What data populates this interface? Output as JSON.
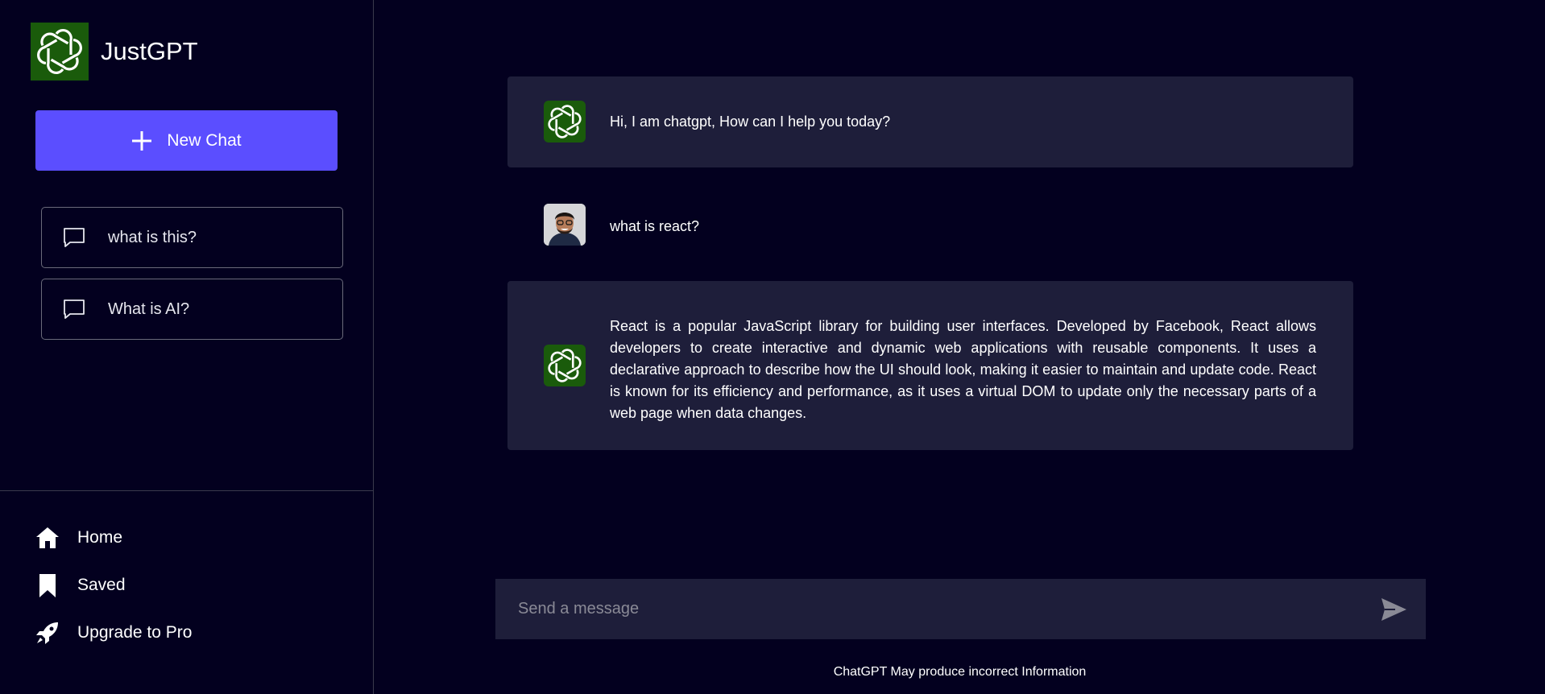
{
  "brand": {
    "name": "JustGPT",
    "logo_icon": "openai-logo-icon",
    "logo_bg": "#1a5b0b"
  },
  "sidebar": {
    "new_chat_label": "New Chat",
    "history": [
      {
        "label": "what is this?",
        "icon": "chat-bubble-icon"
      },
      {
        "label": "What is AI?",
        "icon": "chat-bubble-icon"
      }
    ],
    "nav": [
      {
        "label": "Home",
        "icon": "home-icon"
      },
      {
        "label": "Saved",
        "icon": "bookmark-icon"
      },
      {
        "label": "Upgrade to Pro",
        "icon": "rocket-icon"
      }
    ]
  },
  "chat": {
    "messages": [
      {
        "role": "bot",
        "text": "Hi, I am chatgpt, How can I help you today?"
      },
      {
        "role": "user",
        "text": "what is react?"
      },
      {
        "role": "bot",
        "text": "React is a popular JavaScript library for building user interfaces. Developed by Facebook, React allows developers to create interactive and dynamic web applications with reusable components. It uses a declarative approach to describe how the UI should look, making it easier to maintain and update code. React is known for its efficiency and performance, as it uses a virtual DOM to update only the necessary parts of a web page when data changes."
      }
    ]
  },
  "composer": {
    "placeholder": "Send a message",
    "send_icon": "send-icon"
  },
  "footer": {
    "note": "ChatGPT May produce incorrect Information"
  },
  "colors": {
    "background": "#03001f",
    "accent": "#5b4eff",
    "bubble": "#1e1e3a"
  }
}
